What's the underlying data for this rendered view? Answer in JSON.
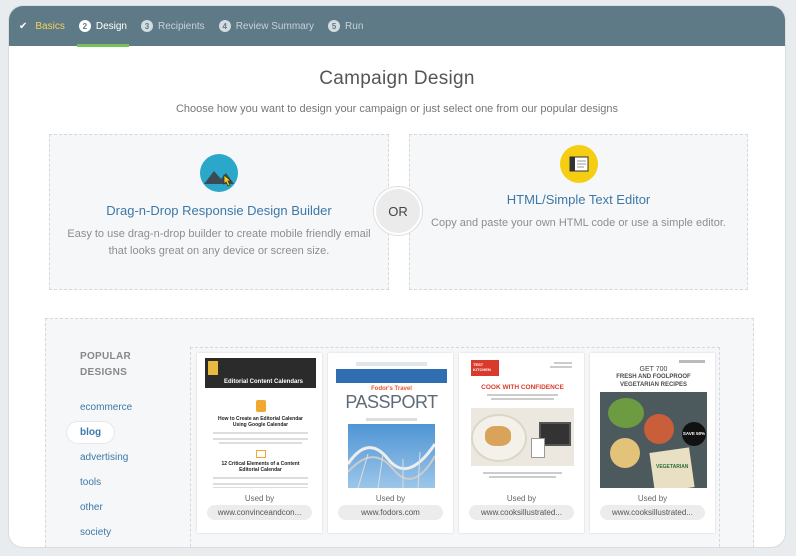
{
  "stepper": {
    "steps": [
      {
        "label": "Basics",
        "num": ""
      },
      {
        "label": "Design",
        "num": "2"
      },
      {
        "label": "Recipients",
        "num": "3"
      },
      {
        "label": "Review Summary",
        "num": "4"
      },
      {
        "label": "Run",
        "num": "5"
      }
    ]
  },
  "main": {
    "title": "Campaign Design",
    "subtitle": "Choose how you want to design your campaign or just select one from our popular designs"
  },
  "options": {
    "dnd": {
      "heading": "Drag-n-Drop Responsie Design Builder",
      "desc_line1": "Easy to use drag-n-drop builder to create mobile friendly email",
      "desc_line2": "that looks great on any device or screen size."
    },
    "or_label": "OR",
    "html": {
      "heading": "HTML/Simple Text Editor",
      "desc": "Copy and paste your own HTML code or use a simple editor."
    }
  },
  "popular": {
    "label_line1": "POPULAR",
    "label_line2": "DESIGNS",
    "categories": [
      "ecommerce",
      "blog",
      "advertising",
      "tools",
      "other",
      "society"
    ],
    "selected_category": "blog",
    "templates": [
      {
        "used_by": "Used by",
        "url": "www.convinceandcon...",
        "thumb_title": "Editorial Content Calendars",
        "thumb_h1": "How to Create an Editorial Calendar Using Google Calendar",
        "thumb_h2": "12 Critical Elements of a Content Editorial Calendar"
      },
      {
        "used_by": "Used by",
        "url": "www.fodors.com",
        "thumb_brand": "Fodor's Travel",
        "thumb_title": "PASSPORT"
      },
      {
        "used_by": "Used by",
        "url": "www.cooksillustrated...",
        "thumb_brand": "TEST KITCHEN",
        "thumb_title": "COOK WITH CONFIDENCE"
      },
      {
        "used_by": "Used by",
        "url": "www.cooksillustrated...",
        "thumb_line1": "GET 700",
        "thumb_line2": "FRESH AND FOOLPROOF",
        "thumb_line3": "VEGETARIAN RECIPES",
        "thumb_badge": "SAVE 50%",
        "thumb_book": "VEGETARIAN"
      }
    ]
  },
  "colors": {
    "stepper_bg": "#5f7a87",
    "active_underline": "#78c257",
    "done_label": "#f2d25b",
    "link_blue": "#3c78a8",
    "dnd_icon": "#2aa7c9",
    "html_icon": "#f5ce12"
  }
}
